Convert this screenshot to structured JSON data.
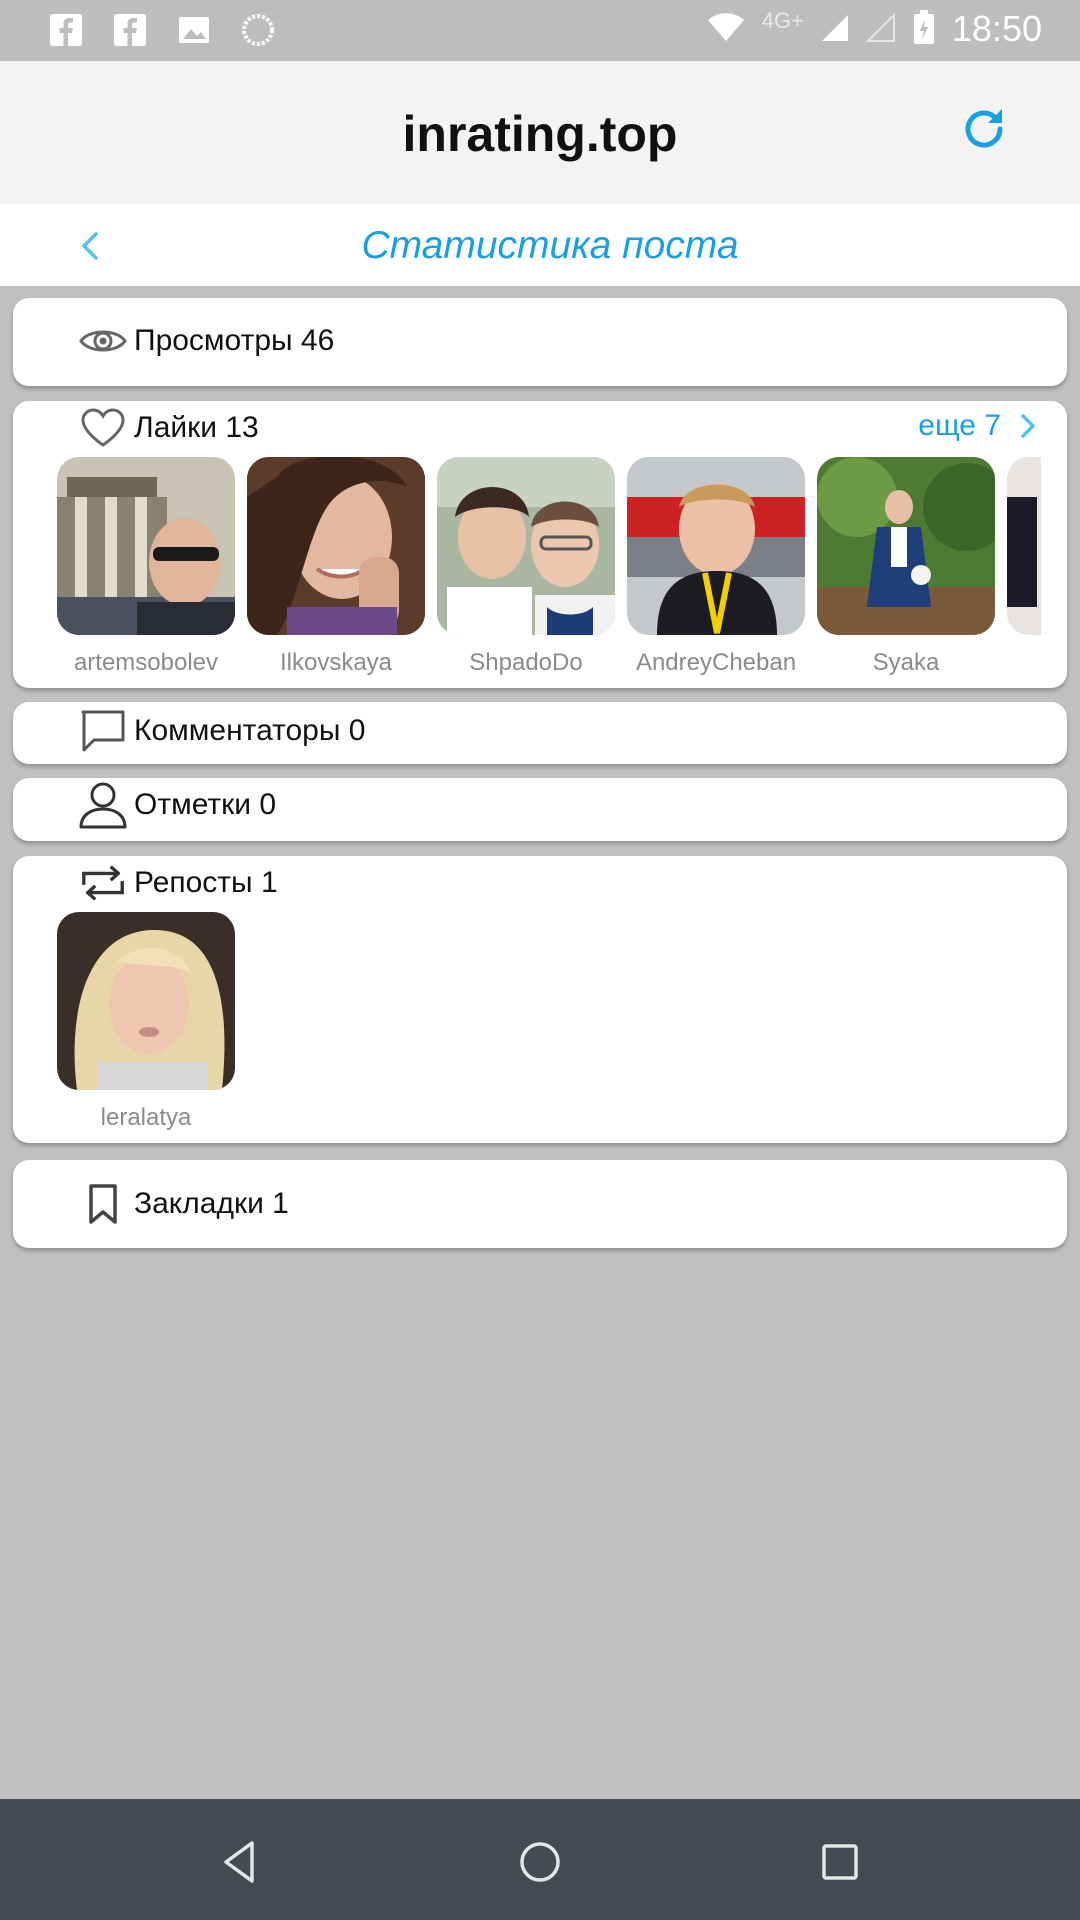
{
  "status_bar": {
    "time": "18:50",
    "network": "4G+",
    "icons": [
      "facebook-icon",
      "facebook-icon",
      "image-icon",
      "loading-icon",
      "wifi-icon",
      "signal-icon",
      "signal-empty-icon",
      "battery-icon"
    ]
  },
  "header": {
    "title": "inrating.top",
    "refresh_icon": "refresh-icon",
    "accent": "#1a9fe0"
  },
  "subheader": {
    "title": "Статистика поста",
    "back_icon": "chevron-left-icon"
  },
  "stats": {
    "views": {
      "label": "Просмотры 46",
      "icon": "eye-icon"
    },
    "likes": {
      "label": "Лайки 13",
      "icon": "heart-icon",
      "more_label": "еще 7",
      "users": [
        "artemsobolev",
        "Ilkovskaya",
        "ShpadoDo",
        "AndreyCheban",
        "Syaka"
      ]
    },
    "commenters": {
      "label": "Комментаторы 0",
      "icon": "comment-icon"
    },
    "tags": {
      "label": "Отметки 0",
      "icon": "person-icon"
    },
    "reposts": {
      "label": "Репосты 1",
      "icon": "repost-icon",
      "users": [
        "leralatya"
      ]
    },
    "bookmarks": {
      "label": "Закладки 1",
      "icon": "bookmark-icon"
    }
  },
  "nav_bar": {
    "buttons": [
      "back-triangle-icon",
      "home-circle-icon",
      "recents-square-icon"
    ]
  }
}
